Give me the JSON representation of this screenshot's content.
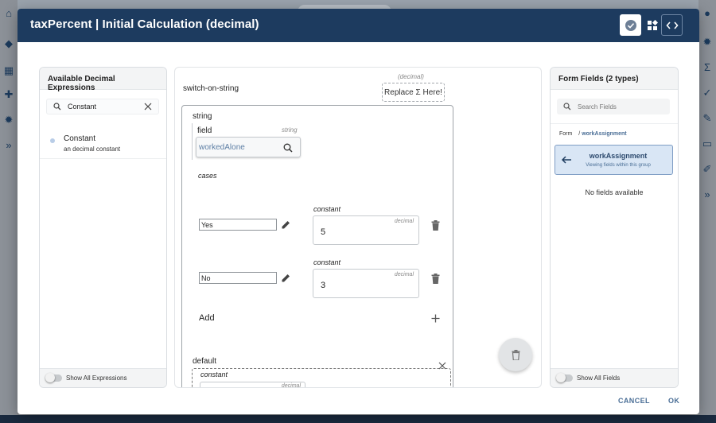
{
  "dialog": {
    "title": "taxPercent | Initial Calculation (decimal)",
    "cancel_label": "CANCEL",
    "ok_label": "OK"
  },
  "left_panel": {
    "title": "Available Decimal Expressions",
    "search_value": "Constant",
    "items": [
      {
        "name": "Constant",
        "description": "an decimal constant"
      }
    ],
    "footer_toggle_label": "Show All Expressions"
  },
  "center": {
    "root_label": "switch-on-string",
    "replace_hint": "(decimal)",
    "replace_label": "Replace Σ Here!",
    "string_label": "string",
    "field_label": "field",
    "field_type_hint": "string",
    "field_value": "workedAlone",
    "cases_label": "cases",
    "cases": [
      {
        "key": "Yes",
        "expr_label": "constant",
        "type_hint": "decimal",
        "value": "5"
      },
      {
        "key": "No",
        "expr_label": "constant",
        "type_hint": "decimal",
        "value": "3"
      }
    ],
    "add_label": "Add",
    "default_label": "default",
    "default_expr_label": "constant",
    "default_type_hint": "decimal"
  },
  "right_panel": {
    "title": "Form Fields (2 types)",
    "search_placeholder": "Search Fields",
    "breadcrumb_root": "Form",
    "breadcrumb_current": "workAssignment",
    "group_name": "workAssignment",
    "group_hint": "Viewing fields within this group",
    "empty_text": "No fields available",
    "footer_toggle_label": "Show All Fields"
  },
  "colors": {
    "header_bg": "#1d3b5f",
    "accent": "#4a6e96",
    "group_bg": "#d9e6f5"
  }
}
